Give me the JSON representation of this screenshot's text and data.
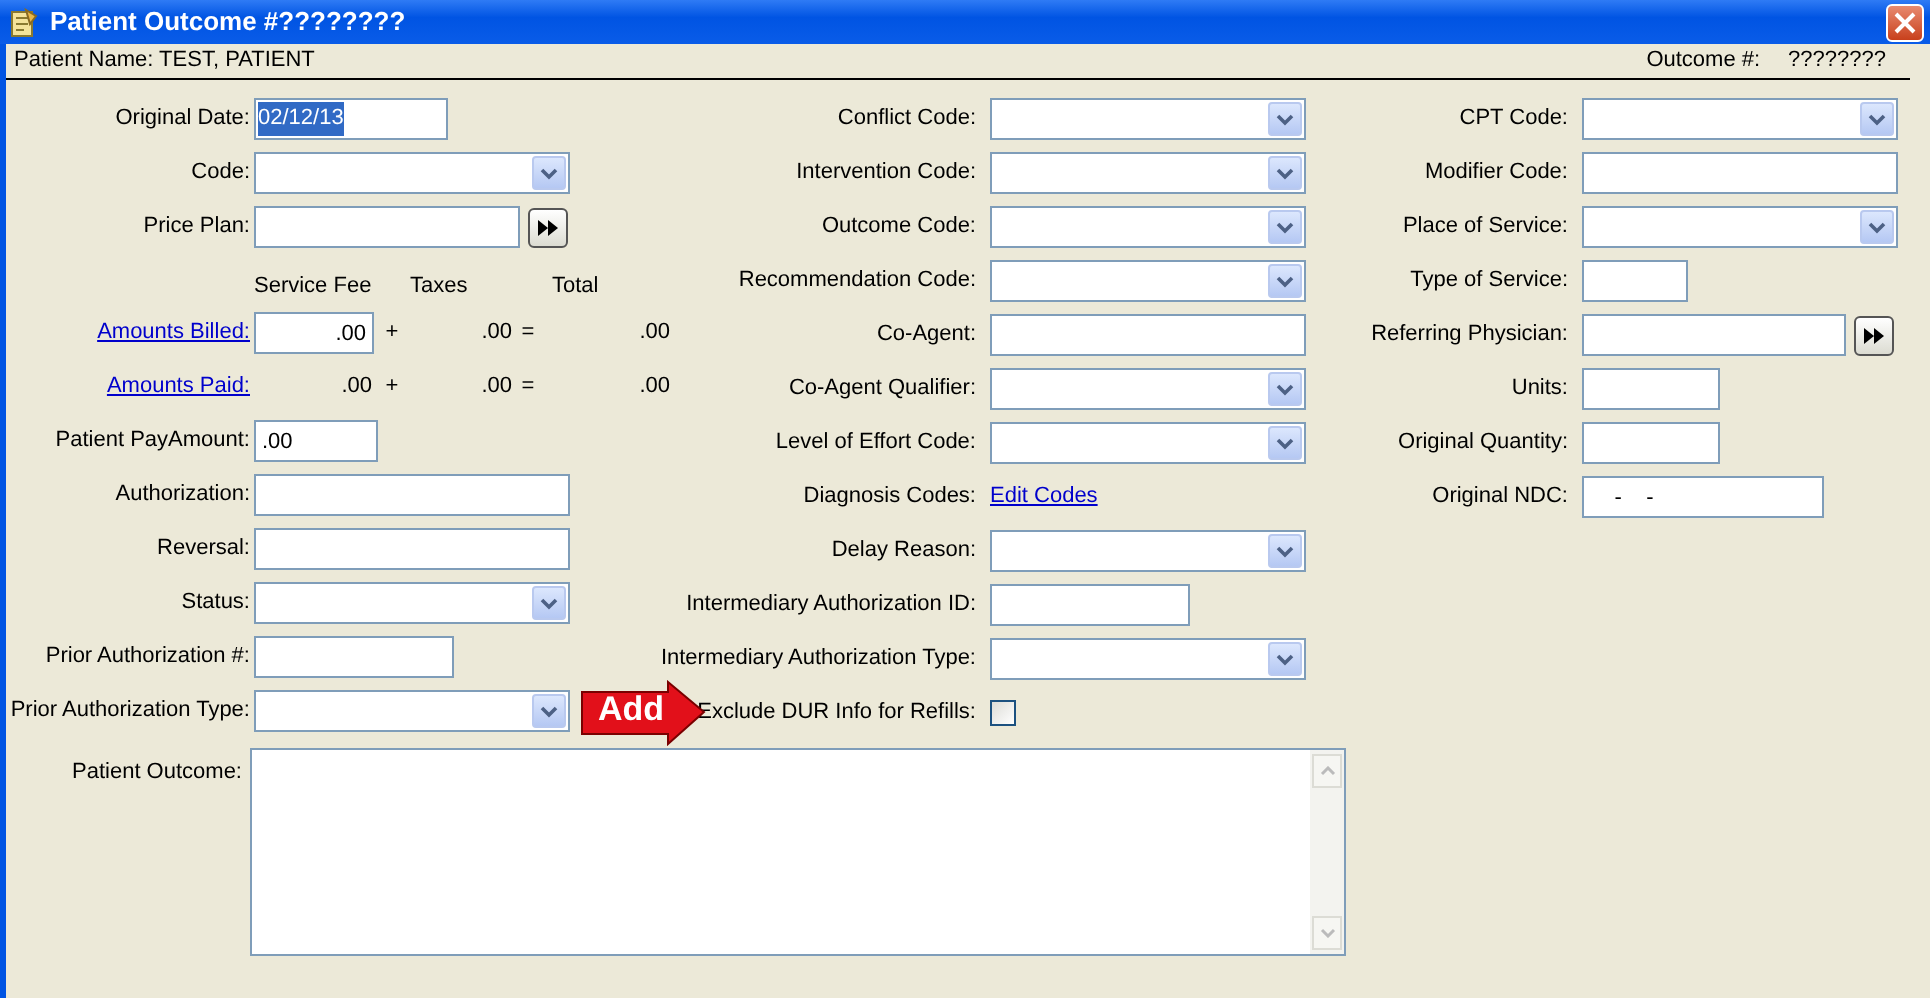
{
  "window": {
    "title": "Patient Outcome #????????"
  },
  "header": {
    "patient_name": "Patient Name:  TEST, PATIENT",
    "outcome_label": "Outcome #:",
    "outcome_number": "????????"
  },
  "columns": [
    {
      "fields": [
        {
          "kind": "text",
          "label": "Original Date:",
          "value": "02/12/13",
          "text_selected": true
        },
        {
          "kind": "select",
          "label": "Code:"
        },
        {
          "kind": "text",
          "label": "Price Plan:",
          "lookup_button": true
        },
        {
          "kind": "fee-header",
          "headings": [
            "Service Fee",
            "Taxes",
            "Total"
          ]
        },
        {
          "kind": "fee",
          "label": "Amounts Billed:",
          "service_fee": ".00",
          "editable": true,
          "plus": "+",
          "taxes": ".00",
          "equals": "=",
          "total": ".00"
        },
        {
          "kind": "fee",
          "label": "Amounts Paid:",
          "service_fee": ".00",
          "editable": false,
          "plus": "+",
          "taxes": ".00",
          "equals": "=",
          "total": ".00"
        },
        {
          "kind": "text",
          "label": "Patient PayAmount:",
          "value": ".00"
        },
        {
          "kind": "text",
          "label": "Authorization:"
        },
        {
          "kind": "text",
          "label": "Reversal:"
        },
        {
          "kind": "select",
          "label": "Status:"
        },
        {
          "kind": "text",
          "label": "Prior Authorization #:"
        },
        {
          "kind": "select",
          "label": "Prior Authorization Type:"
        }
      ]
    },
    {
      "fields": [
        {
          "kind": "select",
          "label": "Conflict Code:"
        },
        {
          "kind": "select",
          "label": "Intervention Code:"
        },
        {
          "kind": "select",
          "label": "Outcome Code:"
        },
        {
          "kind": "select",
          "label": "Recommendation Code:"
        },
        {
          "kind": "text",
          "label": "Co-Agent:"
        },
        {
          "kind": "select",
          "label": "Co-Agent Qualifier:"
        },
        {
          "kind": "select",
          "label": "Level of Effort Code:"
        },
        {
          "kind": "link",
          "label": "Diagnosis Codes:",
          "link": "Edit Codes"
        },
        {
          "kind": "select",
          "label": "Delay Reason:"
        },
        {
          "kind": "text",
          "label": "Intermediary Authorization ID:"
        },
        {
          "kind": "select",
          "label": "Intermediary Authorization Type:"
        },
        {
          "kind": "checkbox",
          "label": "Exclude DUR Info for Refills:",
          "checked": false
        }
      ]
    },
    {
      "fields": [
        {
          "kind": "select",
          "label": "CPT Code:"
        },
        {
          "kind": "text",
          "label": "Modifier Code:"
        },
        {
          "kind": "select",
          "label": "Place of Service:"
        },
        {
          "kind": "text",
          "label": "Type of Service:"
        },
        {
          "kind": "text",
          "label": "Referring Physician:",
          "lookup_button": true
        },
        {
          "kind": "text",
          "label": "Units:"
        },
        {
          "kind": "text",
          "label": "Original Quantity:"
        },
        {
          "kind": "text",
          "label": "Original NDC:",
          "value": "    -    -"
        }
      ]
    }
  ],
  "patient_outcome": {
    "label": "Patient Outcome:"
  },
  "callout": {
    "text": "Add"
  }
}
